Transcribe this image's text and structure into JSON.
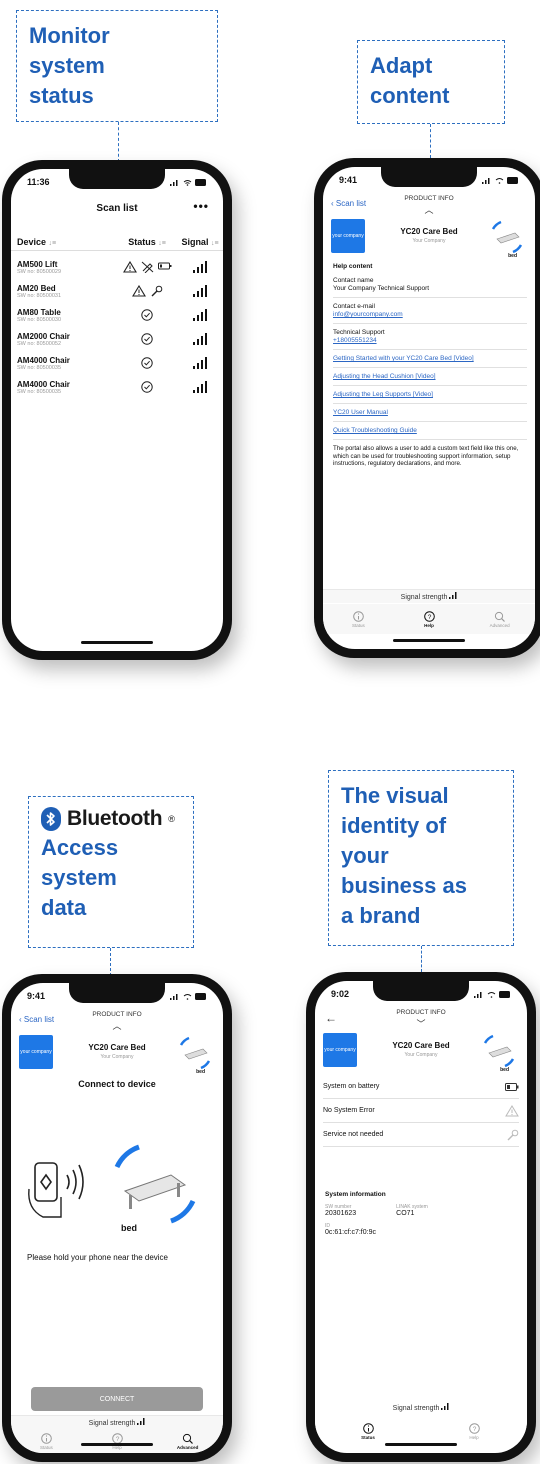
{
  "callouts": {
    "monitor": "Monitor system status",
    "adapt": "Adapt content",
    "bluetooth_word": "Bluetooth",
    "bluetooth_reg": "®",
    "access": "Access system data",
    "visual": "The visual identity of your business as a brand"
  },
  "colors": {
    "accent": "#1f5fb5",
    "link": "#2b66c4",
    "logo_blue": "#1e78e6",
    "connect_btn": "#9a9a9a"
  },
  "phone1": {
    "time": "11:36",
    "title": "Scan list",
    "more": "•••",
    "columns": {
      "device": "Device",
      "status": "Status",
      "signal": "Signal"
    },
    "rows": [
      {
        "name": "AM500 Lift",
        "sw": "SW no: 80500029",
        "status": [
          "warning-icon",
          "no-service-icon",
          "battery-icon"
        ]
      },
      {
        "name": "AM20 Bed",
        "sw": "SW no: 80500031",
        "status": [
          "warning-icon",
          "wrench-icon"
        ]
      },
      {
        "name": "AM80 Table",
        "sw": "SW no: 80500030",
        "status": [
          "check-circle-icon"
        ]
      },
      {
        "name": "AM2000 Chair",
        "sw": "SW no: 80500052",
        "status": [
          "check-circle-icon"
        ]
      },
      {
        "name": "AM4000 Chair",
        "sw": "SW no: 80500035",
        "status": [
          "check-circle-icon"
        ]
      },
      {
        "name": "AM4000 Chair",
        "sw": "SW no: 80500035",
        "status": [
          "check-circle-icon"
        ]
      }
    ]
  },
  "phone2": {
    "time": "9:41",
    "back": "Scan list",
    "header": "PRODUCT INFO",
    "logo_text": "your company",
    "product": "YC20 Care Bed",
    "company": "Your Company",
    "bed_label": "bed",
    "help_heading": "Help content",
    "contact_name_label": "Contact name",
    "contact_name": "Your Company Technical Support",
    "email_label": "Contact e-mail",
    "email": "info@yourcompany.com",
    "support_label": "Technical Support",
    "support_phone": "+18005551234",
    "links": [
      "Getting Started with your YC20 Care Bed [Video]",
      "Adjusting the Head Cushion [Video]",
      "Adjusting the Leg Supports [Video]",
      "YC20 User Manual",
      "Quick Troubleshooting Guide"
    ],
    "paragraph": "The portal also allows a user to add a custom text field like this one, which can be used for troubleshooting support information, setup instructions, regulatory declarations, and more.",
    "signal": "Signal strength",
    "tabs": [
      "Status",
      "Help",
      "Advanced"
    ]
  },
  "phone3": {
    "time": "9:41",
    "back": "Scan list",
    "header": "PRODUCT INFO",
    "logo_text": "your company",
    "product": "YC20 Care Bed",
    "company": "Your Company",
    "bed_label": "bed",
    "connect_title": "Connect to device",
    "big_bed_label": "bed",
    "hold_text": "Please hold your phone near the device",
    "connect_button": "CONNECT",
    "signal": "Signal strength",
    "tabs": [
      "Status",
      "Help",
      "Advanced"
    ]
  },
  "phone4": {
    "time": "9:02",
    "header": "PRODUCT INFO",
    "logo_text": "your company",
    "product": "YC20 Care Bed",
    "company": "Your Company",
    "bed_label": "bed",
    "items": [
      "System on battery",
      "No System Error",
      "Service not needed"
    ],
    "sysinfo_heading": "System information",
    "sw_label": "SW number",
    "sw_value": "20301623",
    "linak_label": "LINAK system",
    "linak_value": "CO71",
    "id_label": "ID",
    "id_value": "0c:61:cf:c7:f0:9c",
    "signal": "Signal strength",
    "tabs": [
      "Status",
      "Help"
    ]
  }
}
